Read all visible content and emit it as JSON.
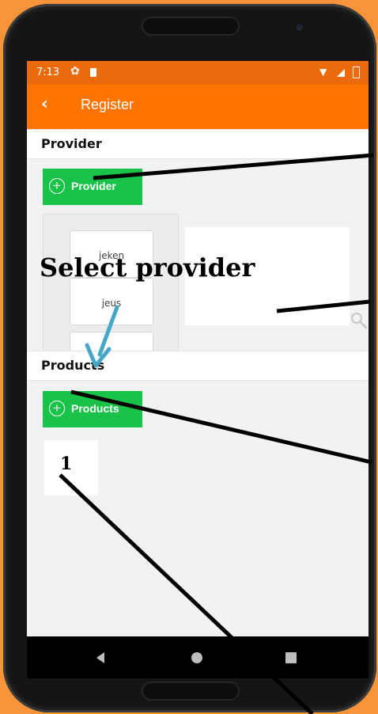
{
  "statusbar": {
    "time": "7:13"
  },
  "appbar": {
    "back_symbol": "‹",
    "title": "Register"
  },
  "provider_section": {
    "header": "Provider",
    "add_button_label": "Provider",
    "list": [
      "jeken",
      "jeus"
    ]
  },
  "products_section": {
    "header": "Products",
    "add_button_label": "Products"
  },
  "annotations": {
    "select_provider": "Select provider",
    "number_1": "1"
  },
  "icons": {
    "back": "back-arrow-icon",
    "settings": "gear-icon",
    "sd": "sd-card-icon",
    "wifi": "wifi-icon",
    "signal": "signal-icon",
    "battery": "battery-icon",
    "add": "plus-circle-icon",
    "search": "search-icon"
  },
  "colors": {
    "background": "#f7943a",
    "statusbar": "#ea6a0c",
    "appbar": "#ff7300",
    "button_green": "#19c34a",
    "arrow_blue": "#47a7c8"
  }
}
